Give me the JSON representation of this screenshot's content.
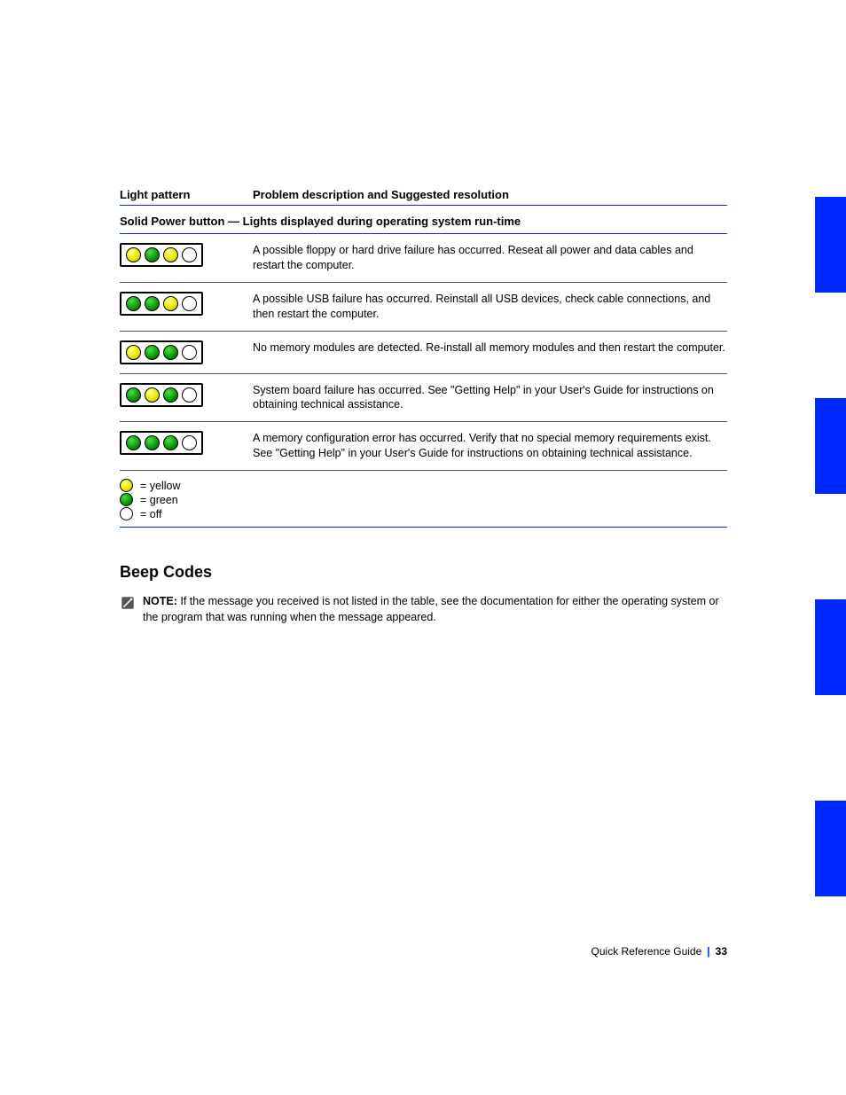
{
  "table": {
    "header_left": "Light pattern",
    "header_right": "Problem description and Suggested resolution",
    "subhead": "Solid Power button — Lights displayed during operating system run-time",
    "rows": [
      {
        "leds": [
          "yellow",
          "green",
          "yellow",
          "off"
        ],
        "text": "A possible floppy or hard drive failure has occurred. Reseat all power and data cables and restart the computer."
      },
      {
        "leds": [
          "green",
          "green",
          "yellow",
          "off"
        ],
        "text": "A possible USB failure has occurred. Reinstall all USB devices, check cable connections, and then restart the computer."
      },
      {
        "leds": [
          "yellow",
          "green",
          "green",
          "off"
        ],
        "text": "No memory modules are detected. Re-install all memory modules and then restart the computer."
      },
      {
        "leds": [
          "green",
          "yellow",
          "green",
          "off"
        ],
        "text": "System board failure has occurred. See \"Getting Help\" in your User's Guide for instructions on obtaining technical assistance."
      },
      {
        "leds": [
          "green",
          "green",
          "green",
          "off"
        ],
        "text": "A memory configuration error has occurred. Verify that no special memory requirements exist. See \"Getting Help\" in your User's Guide for instructions on obtaining technical assistance."
      }
    ]
  },
  "legend": {
    "yellow": "= yellow",
    "green": "= green",
    "off": "= off"
  },
  "beep_section": {
    "title": "Beep Codes",
    "note_label": "NOTE:",
    "note_text": "If the message you received is not listed in the table, see the documentation for either the operating system or the program that was running when the message appeared."
  },
  "footer": {
    "label": "Quick Reference Guide",
    "page": "33"
  }
}
